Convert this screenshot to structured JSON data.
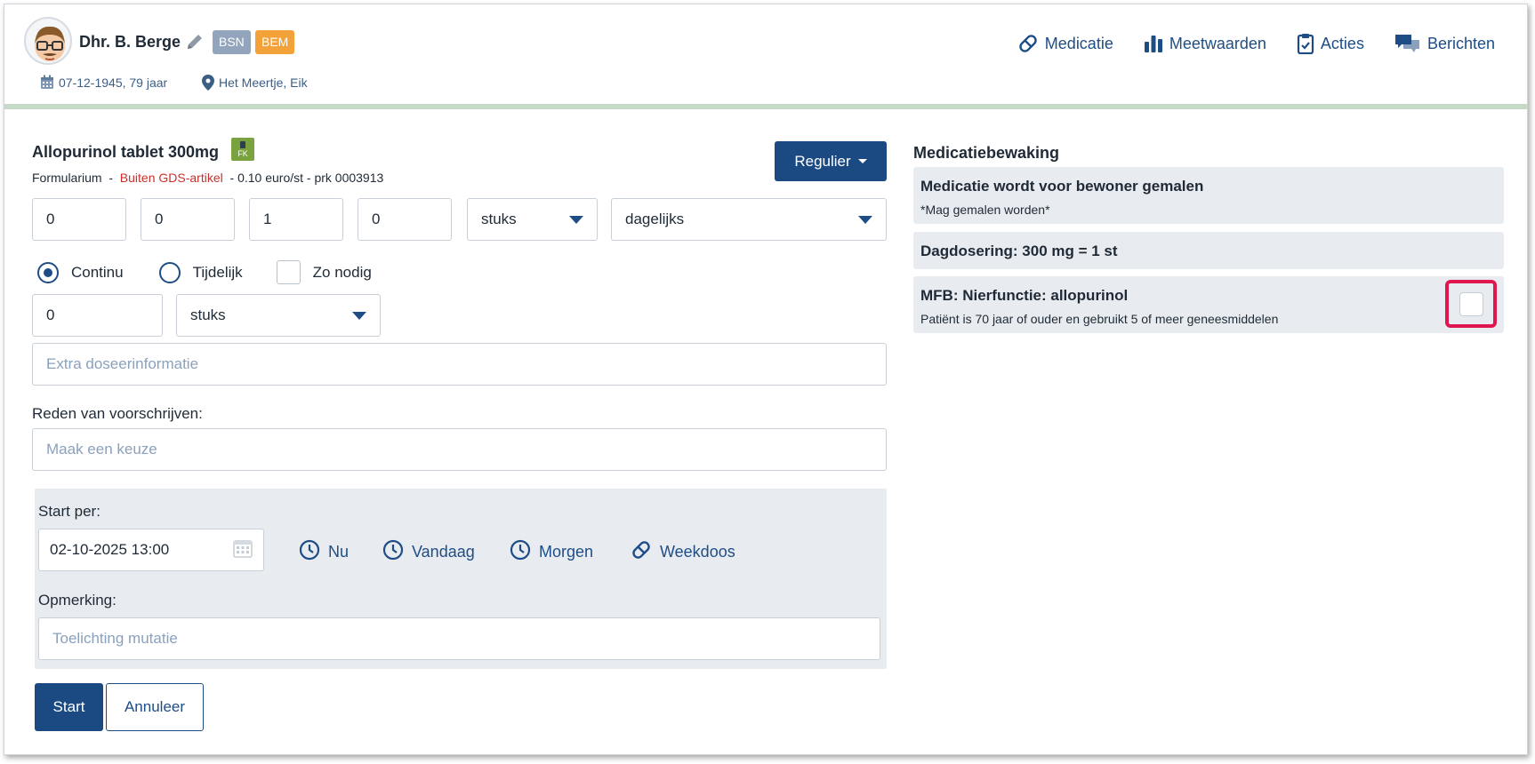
{
  "patient": {
    "name": "Dhr. B. Berge",
    "badges": [
      "BSN",
      "BEM"
    ],
    "dob": "07-12-1945, 79 jaar",
    "location": "Het Meertje, Eik"
  },
  "nav": [
    {
      "label": "Medicatie",
      "icon": "pill-icon"
    },
    {
      "label": "Meetwaarden",
      "icon": "bar-chart-icon"
    },
    {
      "label": "Acties",
      "icon": "clipboard-check-icon"
    },
    {
      "label": "Berichten",
      "icon": "chat-bubbles-icon"
    }
  ],
  "drug": {
    "title": "Allopurinol tablet 300mg",
    "fk_badge": "FK",
    "meta_prefix": "Formularium  -  ",
    "meta_warning": "Buiten GDS-artikel",
    "meta_suffix": "  - 0.10 euro/st - prk 0003913"
  },
  "schedule_button": {
    "label": "Regulier"
  },
  "dose_fields": [
    "0",
    "0",
    "1",
    "0"
  ],
  "unit_select": {
    "value": "stuks"
  },
  "frequency_select": {
    "value": "dagelijks"
  },
  "mode": {
    "options": [
      "Continu",
      "Tijdelijk"
    ],
    "selected": "Continu",
    "as_needed_label": "Zo nodig",
    "as_needed_checked": false
  },
  "amount": {
    "value": "0",
    "unit": "stuks"
  },
  "extra_info": {
    "placeholder": "Extra doseerinformatie"
  },
  "reason": {
    "label": "Reden van voorschrijven:",
    "placeholder": "Maak een keuze"
  },
  "start": {
    "label": "Start per:",
    "datetime": "02-10-2025 13:00",
    "quick_buttons": [
      "Nu",
      "Vandaag",
      "Morgen",
      "Weekdoos"
    ]
  },
  "remark": {
    "label": "Opmerking:",
    "placeholder": "Toelichting mutatie"
  },
  "actions": {
    "start": "Start",
    "cancel": "Annuleer"
  },
  "monitoring": {
    "title": "Medicatiebewaking",
    "items": [
      {
        "heading": "Medicatie wordt voor bewoner gemalen",
        "detail": "*Mag gemalen worden*"
      },
      {
        "heading": "Dagdosering: 300 mg = 1 st",
        "detail": ""
      },
      {
        "heading": "MFB: Nierfunctie: allopurinol",
        "detail": "Patiënt is 70 jaar of ouder en gebruikt 5 of meer geneesmiddelen",
        "checked": false
      }
    ]
  },
  "colors": {
    "primary": "#1b4a83",
    "link": "#1e4d86",
    "warning_text": "#c9302c",
    "badge_bsn": "#93a4bd",
    "badge_bem": "#f3a23a",
    "highlight": "#e0174f",
    "panel_bg": "#e8ecf0",
    "header_rule": "#c5dbc6"
  }
}
